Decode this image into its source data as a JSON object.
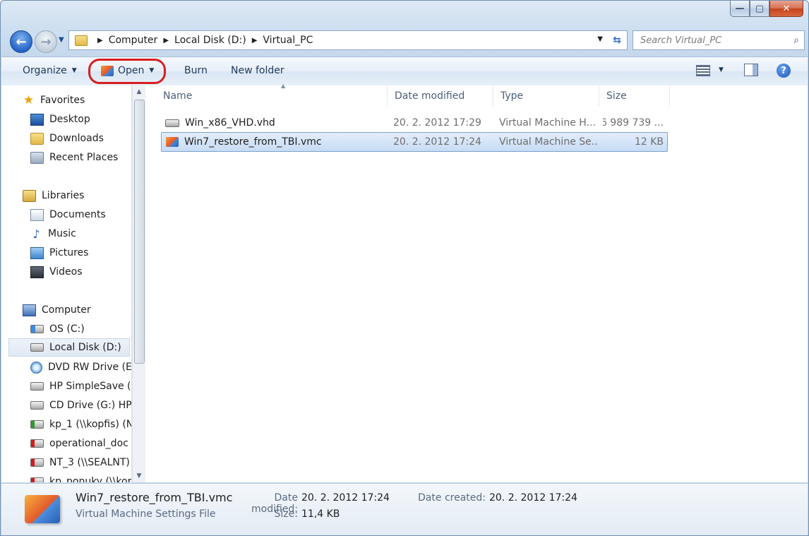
{
  "window": {
    "minimize": "—",
    "maximize": "▢",
    "close": "✕"
  },
  "address": {
    "crumbs": [
      "Computer",
      "Local Disk (D:)",
      "Virtual_PC"
    ]
  },
  "search": {
    "placeholder": "Search Virtual_PC"
  },
  "toolbar": {
    "organize": "Organize",
    "open": "Open",
    "burn": "Burn",
    "new_folder": "New folder",
    "help": "?"
  },
  "sidebar": {
    "items": [
      {
        "label": "Favorites",
        "icon": "star-icon"
      },
      {
        "label": "Desktop",
        "icon": "desktop-icon"
      },
      {
        "label": "Downloads",
        "icon": "downloads-icon"
      },
      {
        "label": "Recent Places",
        "icon": "recent-places-icon"
      },
      {
        "label": "Libraries",
        "icon": "libraries-icon"
      },
      {
        "label": "Documents",
        "icon": "documents-icon"
      },
      {
        "label": "Music",
        "icon": "music-icon"
      },
      {
        "label": "Pictures",
        "icon": "pictures-icon"
      },
      {
        "label": "Videos",
        "icon": "videos-icon"
      },
      {
        "label": "Computer",
        "icon": "computer-icon"
      },
      {
        "label": "OS (C:)",
        "icon": "drive-icon"
      },
      {
        "label": "Local Disk (D:)",
        "icon": "drive-icon",
        "selected": true
      },
      {
        "label": "DVD RW Drive (E:",
        "icon": "dvd-icon"
      },
      {
        "label": "HP SimpleSave (F",
        "icon": "drive-icon"
      },
      {
        "label": "CD Drive (G:) HP I",
        "icon": "cd-drive-icon"
      },
      {
        "label": "kp_1 (\\\\kopfis) (N",
        "icon": "network-drive-icon"
      },
      {
        "label": "operational_doc (",
        "icon": "network-drive-disconnected-icon"
      },
      {
        "label": "NT_3 (\\\\SEALNT)",
        "icon": "network-drive-disconnected-icon"
      },
      {
        "label": "kp_ponuky (\\\\kop",
        "icon": "network-drive-disconnected-icon"
      }
    ]
  },
  "columns": {
    "name": "Name",
    "date": "Date modified",
    "type": "Type",
    "size": "Size"
  },
  "files": [
    {
      "name": "Win_x86_VHD.vhd",
      "date": "20. 2. 2012 17:29",
      "type": "Virtual Machine H...",
      "size": "6 989 739 ...",
      "icon": "vhd-file-icon"
    },
    {
      "name": "Win7_restore_from_TBI.vmc",
      "date": "20. 2. 2012 17:24",
      "type": "Virtual Machine Se...",
      "size": "12 KB",
      "icon": "vmc-file-icon",
      "selected": true
    }
  ],
  "details": {
    "filename": "Win7_restore_from_TBI.vmc",
    "filetype": "Virtual Machine Settings File",
    "date_modified_label": "Date modified:",
    "date_modified": "20. 2. 2012 17:24",
    "date_created_label": "Date created:",
    "date_created": "20. 2. 2012 17:24",
    "size_label": "Size:",
    "size": "11,4 KB"
  },
  "colors": {
    "accent": "#d61f1f",
    "selection": "#c7dcf5"
  }
}
